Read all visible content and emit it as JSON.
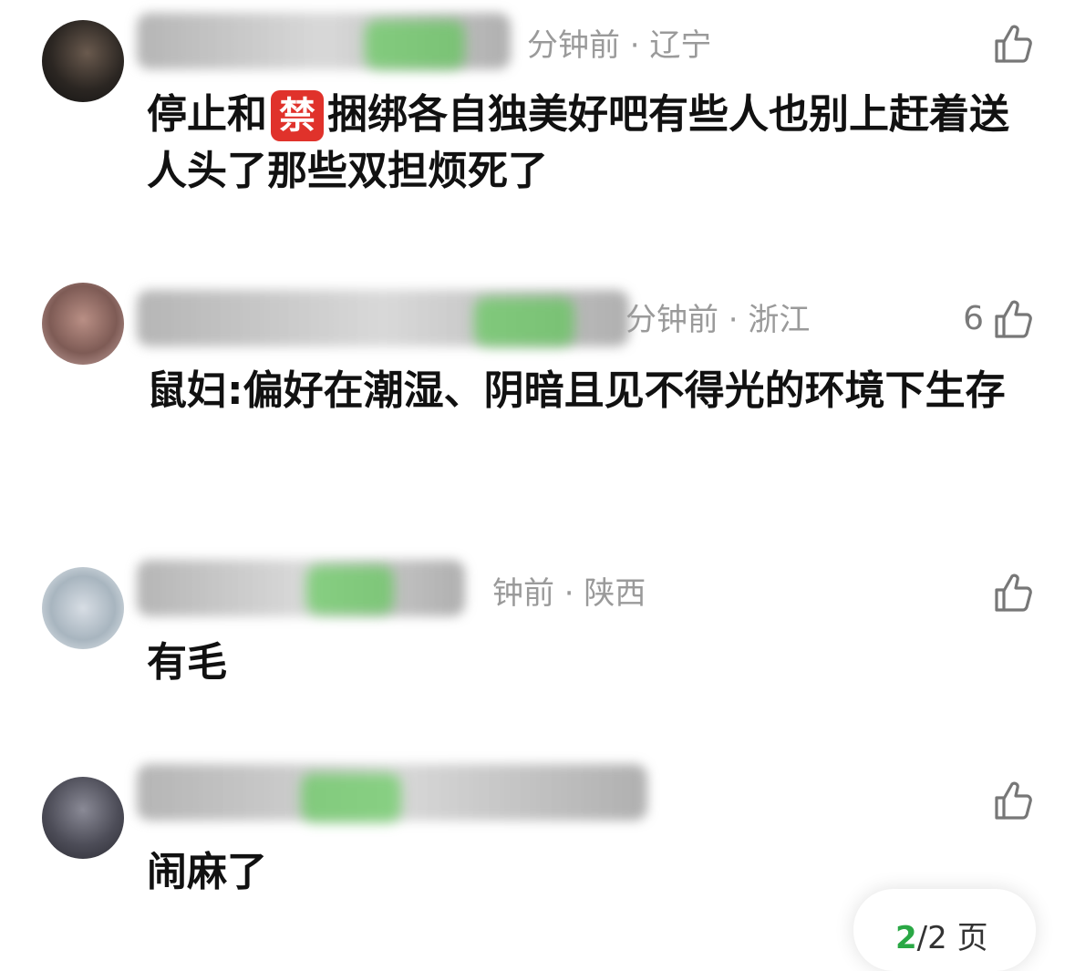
{
  "comments": [
    {
      "meta": "分钟前 · 辽宁",
      "likes": "",
      "text_before": "停止和",
      "emoji": "禁",
      "text_after": "捆绑各自独美好吧有些人也别上赶着送人头了那些双担烦死了"
    },
    {
      "meta": "分钟前 · 浙江",
      "likes": "6",
      "text": "鼠妇:偏好在潮湿、阴暗且见不得光的环境下生存"
    },
    {
      "meta": "钟前 · 陕西",
      "likes": "",
      "text": "有毛"
    },
    {
      "meta": "",
      "likes": "",
      "text": "闹麻了"
    }
  ],
  "pager": {
    "current": "2",
    "rest": "/2 页"
  },
  "icons": {
    "like": "thumbs-up-icon"
  },
  "colors": {
    "text": "#111111",
    "meta": "#9a9a9a",
    "accent": "#2aa845",
    "emoji_bg": "#e0322b"
  }
}
